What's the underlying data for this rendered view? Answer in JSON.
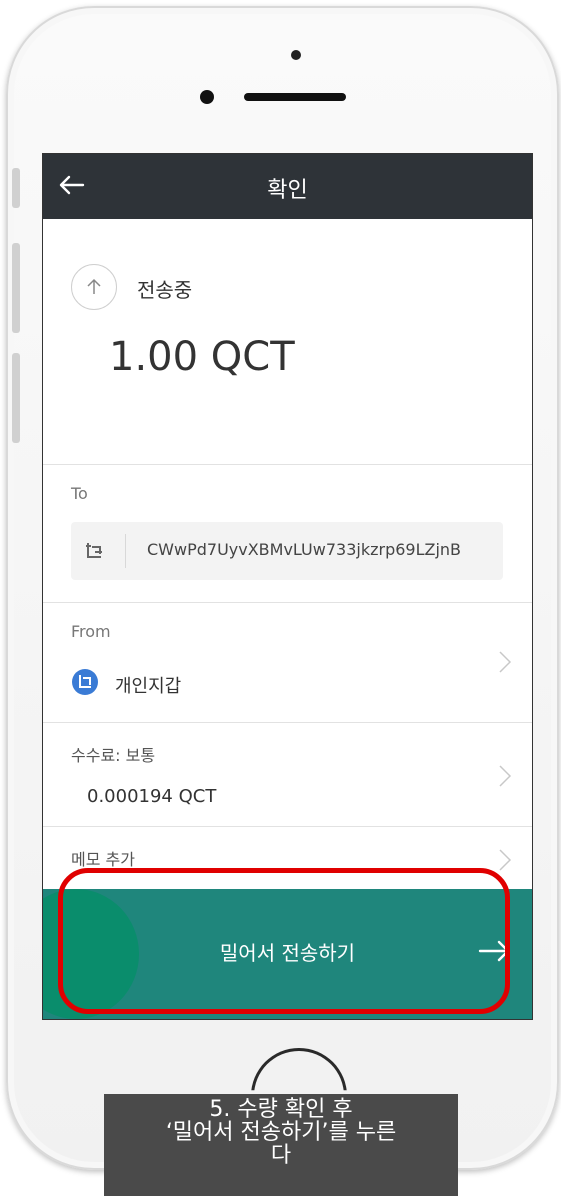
{
  "header": {
    "title": "확인"
  },
  "status": {
    "label": "전송중",
    "icon": "arrow-up-circle-icon"
  },
  "amount": "1.00 QCT",
  "to": {
    "label": "To",
    "address": "CWwPd7UyvXBMvLUw733jkzrp69LZjnB"
  },
  "from": {
    "label": "From",
    "wallet_name": "개인지갑"
  },
  "fee": {
    "label": "수수료: 보통",
    "value": "0.000194 QCT"
  },
  "memo": {
    "label": "메모 추가"
  },
  "slide": {
    "label": "밀어서 전송하기"
  },
  "caption": {
    "line1": "5. 수량 확인 후",
    "line2": "‘밀어서 전송하기’를 누른",
    "line3": "다"
  },
  "colors": {
    "topbar": "#2e3338",
    "slide_bar": "#1f867c",
    "wallet_badge": "#3a7bd5",
    "highlight": "#e00000"
  }
}
